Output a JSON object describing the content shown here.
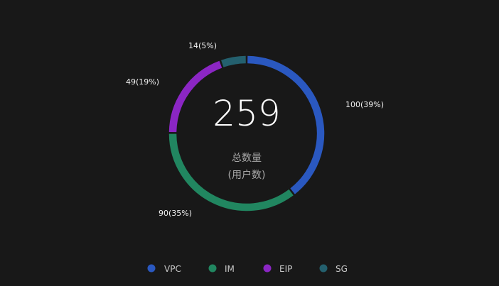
{
  "chart_data": {
    "type": "pie",
    "donut": true,
    "total": 259,
    "center_caption_line1": "总数量",
    "center_caption_line2": "(用户数)",
    "slices": [
      {
        "name": "VPC",
        "value": 100,
        "label": "100(39%)",
        "color": "#2a58c0"
      },
      {
        "name": "IM",
        "value": 90,
        "label": "90(35%)",
        "color": "#218660"
      },
      {
        "name": "EIP",
        "value": 49,
        "label": "49(19%)",
        "color": "#8b26c4"
      },
      {
        "name": "SG",
        "value": 14,
        "label": "14(5%)",
        "color": "#24606e"
      }
    ],
    "legend_position": "bottom"
  }
}
